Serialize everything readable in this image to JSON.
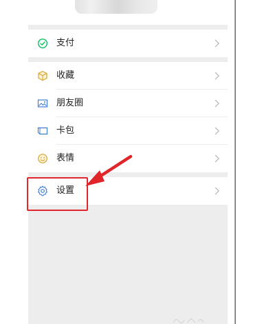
{
  "menu": {
    "groups": [
      {
        "items": [
          {
            "icon": "wechat-pay-icon",
            "label": "支付"
          }
        ]
      },
      {
        "items": [
          {
            "icon": "favorites-icon",
            "label": "收藏"
          },
          {
            "icon": "moments-icon",
            "label": "朋友圈"
          },
          {
            "icon": "cards-icon",
            "label": "卡包"
          },
          {
            "icon": "stickers-icon",
            "label": "表情"
          }
        ]
      },
      {
        "items": [
          {
            "icon": "settings-gear-icon",
            "label": "设置"
          }
        ]
      }
    ]
  },
  "colors": {
    "background": "#ededed",
    "card": "#ffffff",
    "accent_green": "#07c160",
    "annotation_red": "#e0262b",
    "chevron": "#b2b2b2"
  }
}
